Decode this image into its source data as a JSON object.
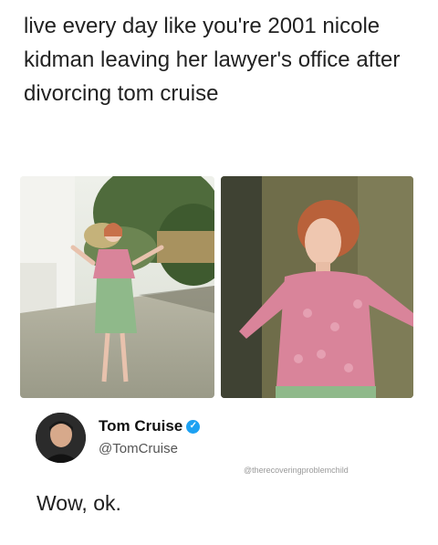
{
  "caption": "live every day like you're 2001 nicole kidman leaving her lawyer's office after divorcing tom cruise",
  "tweet": {
    "name": "Tom Cruise",
    "handle": "@TomCruise",
    "text": "Wow, ok.",
    "verified_glyph": "✓"
  },
  "watermark": "@therecoveringproblemchild",
  "colors": {
    "verified": "#1da1f2",
    "top_pink": "#d9849a",
    "skirt_green": "#8fb98a"
  }
}
